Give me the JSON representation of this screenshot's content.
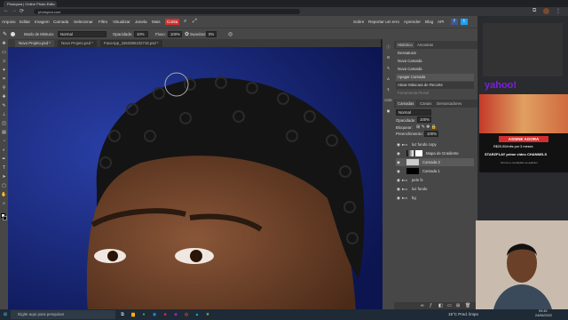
{
  "browser": {
    "tabs": [
      {
        "title": "Photopea | Online Photo Edito"
      }
    ],
    "url": "photopea.com"
  },
  "menubar": {
    "items": [
      "Arquivo",
      "Editar",
      "Imagem",
      "Camada",
      "Selecionar",
      "Filtro",
      "Visualizar",
      "Janela",
      "Mais",
      "Conta"
    ],
    "active": "Conta",
    "right_items": [
      "Sobre",
      "Reportar um erro",
      "Aprender",
      "Blog",
      "API"
    ]
  },
  "options": {
    "blend_label": "Modo de Mistura:",
    "blend_value": "Normal",
    "opacity_label": "Opacidade:",
    "opacity_value": "10%",
    "flow_label": "Fluxo:",
    "flow_value": "100%",
    "smooth_label": "Suavizar:",
    "smooth_value": "0%"
  },
  "doc_tabs": [
    {
      "label": "Novo Projeto.psd *"
    },
    {
      "label": "Novo Projeto.psd *"
    },
    {
      "label": "FaceApp_1653385102718.psd *"
    }
  ],
  "history": {
    "tabs": [
      "Histórico",
      "Amostras"
    ],
    "items": [
      "Dessaturar",
      "Nova Camada",
      "Nova Camada",
      "Apagar Camada",
      "Ativar Máscara de Recorte",
      "Ferramenta Pincel",
      "Ferramenta Pincel"
    ]
  },
  "layers": {
    "tabs": [
      "Camadas",
      "Canais",
      "Demarcadores"
    ],
    "blend": "Normal",
    "opacity_label": "Opacidade:",
    "opacity": "100%",
    "lock_label": "Bloquear:",
    "fill_label": "Preenchimento:",
    "fill": "100%",
    "items": [
      {
        "name": "luz fundo copy",
        "indent": 0
      },
      {
        "name": "Mapa de Gradiente",
        "indent": 1
      },
      {
        "name": "Camada 3",
        "indent": 1
      },
      {
        "name": "Camada 1",
        "indent": 1
      },
      {
        "name": "pele fx",
        "indent": 0
      },
      {
        "name": "luz fundo",
        "indent": 0
      },
      {
        "name": "bg",
        "indent": 0
      }
    ]
  },
  "ads": {
    "brand": "yahoo!",
    "banner": "ASSINE AGORA",
    "price": "R$20,90/mês por 3 meses",
    "partners": "STARZPLAY prime video CHANNELS",
    "disclaimer": "Termos e condições se aplicam"
  },
  "taskbar": {
    "search_placeholder": "Digite aqui para pesquisar",
    "weather": "15°C  Pred. limpo",
    "time": "09:45",
    "date": "24/06/2022"
  },
  "colors": {
    "accent": "#d32f2f",
    "panel": "#474747",
    "canvas_bg": "#1a2a6a"
  }
}
